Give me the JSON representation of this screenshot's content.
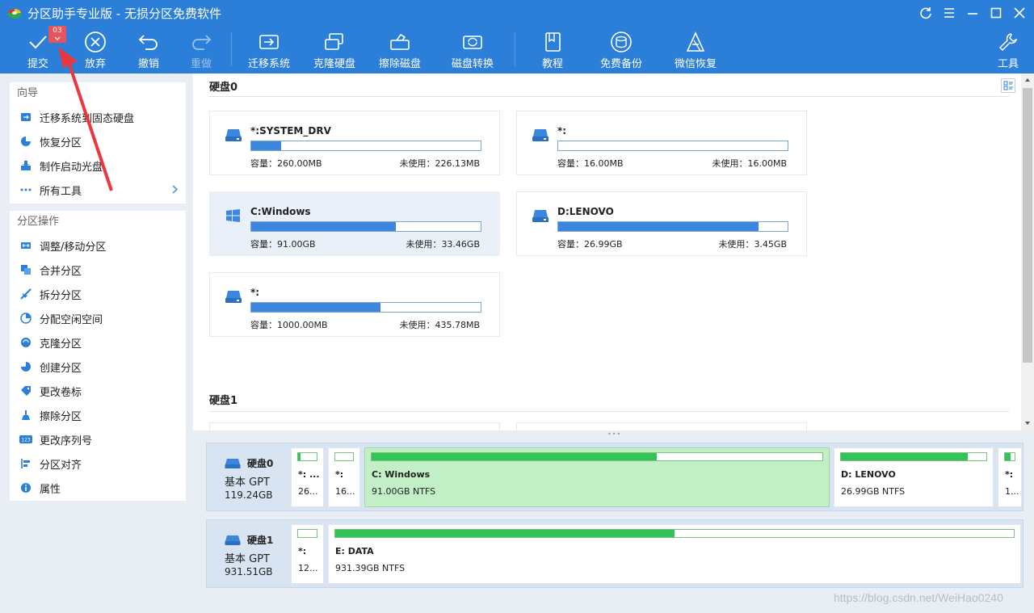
{
  "app": {
    "title": "分区助手专业版 - 无损分区免费软件"
  },
  "colors": {
    "accent": "#2b7fd9",
    "badge": "#e8545d",
    "disk_bar": "#3c87dd",
    "partition_bar": "#33c458",
    "arrow": "#e8383d"
  },
  "toolbar": {
    "pending_count": "03",
    "commit_label": "提交",
    "discard_label": "放弃",
    "undo_label": "撤销",
    "redo_label": "重做",
    "migrate_label": "迁移系统",
    "clone_label": "克隆硬盘",
    "wipe_label": "擦除磁盘",
    "convert_label": "磁盘转换",
    "tutorial_label": "教程",
    "backup_label": "免费备份",
    "wechat_label": "微信恢复",
    "tools_label": "工具"
  },
  "sidebar": {
    "wizard_title": "向导",
    "wizard_items": [
      {
        "label": "迁移系统到固态硬盘",
        "icon": "migrate-icon"
      },
      {
        "label": "恢复分区",
        "icon": "recover-icon"
      },
      {
        "label": "制作启动光盘",
        "icon": "bootdisk-icon"
      },
      {
        "label": "所有工具",
        "icon": "more-icon"
      }
    ],
    "ops_title": "分区操作",
    "ops_items": [
      {
        "label": "调整/移动分区",
        "icon": "resize-icon"
      },
      {
        "label": "合并分区",
        "icon": "merge-icon"
      },
      {
        "label": "拆分分区",
        "icon": "split-icon"
      },
      {
        "label": "分配空闲空间",
        "icon": "allocate-icon"
      },
      {
        "label": "克隆分区",
        "icon": "clone-icon"
      },
      {
        "label": "创建分区",
        "icon": "create-icon"
      },
      {
        "label": "更改卷标",
        "icon": "label-icon"
      },
      {
        "label": "擦除分区",
        "icon": "wipe-icon"
      },
      {
        "label": "更改序列号",
        "icon": "serial-icon"
      },
      {
        "label": "分区对齐",
        "icon": "align-icon"
      },
      {
        "label": "属性",
        "icon": "info-icon"
      }
    ]
  },
  "disk_view": {
    "disk0_title": "硬盘0",
    "disk1_title": "硬盘1",
    "capacity_label": "容量：",
    "free_label": "未使用：",
    "cards": [
      {
        "name": "*:SYSTEM_DRV",
        "capacity": "260.00MB",
        "free": "226.13MB",
        "used_fraction": 0.13,
        "selected": false,
        "icon": "drive-icon"
      },
      {
        "name": "*:",
        "capacity": "16.00MB",
        "free": "16.00MB",
        "used_fraction": 0.0,
        "selected": false,
        "icon": "drive-icon"
      },
      {
        "name": "C:Windows",
        "capacity": "91.00GB",
        "free": "33.46GB",
        "used_fraction": 0.632,
        "selected": true,
        "icon": "windows-icon"
      },
      {
        "name": "D:LENOVO",
        "capacity": "26.99GB",
        "free": "3.45GB",
        "used_fraction": 0.872,
        "selected": false,
        "icon": "drive-icon"
      },
      {
        "name": "*:",
        "capacity": "1000.00MB",
        "free": "435.78MB",
        "used_fraction": 0.564,
        "selected": false,
        "icon": "drive-icon"
      }
    ]
  },
  "disk_map": {
    "disks": [
      {
        "title": "硬盘0",
        "kind": "基本 GPT",
        "size": "119.24GB",
        "partitions": [
          {
            "name": "*: ...",
            "info": "26...",
            "used_fraction": 0.13,
            "selected": false
          },
          {
            "name": "*:",
            "info": "16...",
            "used_fraction": 0.0,
            "selected": false
          },
          {
            "name": "C: Windows",
            "info": "91.00GB NTFS",
            "used_fraction": 0.632,
            "selected": true
          },
          {
            "name": "D: LENOVO",
            "info": "26.99GB NTFS",
            "used_fraction": 0.872,
            "selected": false
          },
          {
            "name": "*:",
            "info": "1...",
            "used_fraction": 0.56,
            "selected": false
          }
        ]
      },
      {
        "title": "硬盘1",
        "kind": "基本 GPT",
        "size": "931.51GB",
        "partitions": [
          {
            "name": "*:",
            "info": "12...",
            "used_fraction": 0.0,
            "selected": false
          },
          {
            "name": "E: DATA",
            "info": "931.39GB NTFS",
            "used_fraction": 0.5,
            "selected": false
          }
        ]
      }
    ]
  },
  "watermark": "https://blog.csdn.net/WeiHao0240"
}
